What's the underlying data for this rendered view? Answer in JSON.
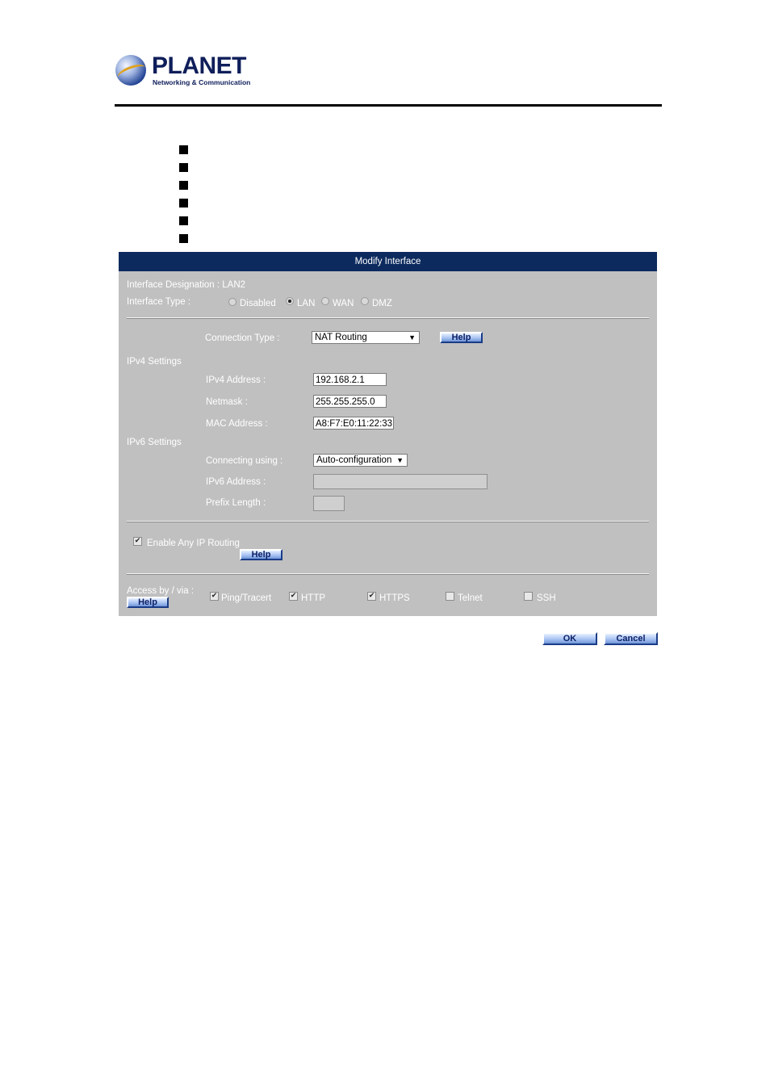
{
  "logo": {
    "brand": "PLANET",
    "tagline": "Networking & Communication"
  },
  "panel": {
    "title": "Modify Interface",
    "designation_label": "Interface Designation : ",
    "designation_value": "LAN2",
    "type_label": "Interface Type :",
    "type_options": [
      "Disabled",
      "LAN",
      "WAN",
      "DMZ"
    ],
    "type_selected": "LAN",
    "connection_type_label": "Connection Type :",
    "connection_type_value": "NAT Routing",
    "help_label": "Help",
    "ipv4_heading": "IPv4 Settings",
    "ipv4_address_label": "IPv4 Address :",
    "ipv4_address_value": "192.168.2.1",
    "netmask_label": "Netmask :",
    "netmask_value": "255.255.255.0",
    "mac_label": "MAC Address :",
    "mac_value": "A8:F7:E0:11:22:33",
    "ipv6_heading": "IPv6 Settings",
    "connecting_using_label": "Connecting using :",
    "connecting_using_value": "Auto-configuration",
    "ipv6_address_label": "IPv6 Address :",
    "ipv6_address_value": "",
    "prefix_length_label": "Prefix Length :",
    "prefix_length_value": "",
    "any_ip_label": "Enable Any IP Routing",
    "any_ip_checked": true,
    "access_label": "Access by / via :",
    "access_options": [
      {
        "label": "Ping/Tracert",
        "checked": true
      },
      {
        "label": "HTTP",
        "checked": true
      },
      {
        "label": "HTTPS",
        "checked": true
      },
      {
        "label": "Telnet",
        "checked": false
      },
      {
        "label": "SSH",
        "checked": false
      }
    ]
  },
  "buttons": {
    "ok": "OK",
    "cancel": "Cancel"
  }
}
